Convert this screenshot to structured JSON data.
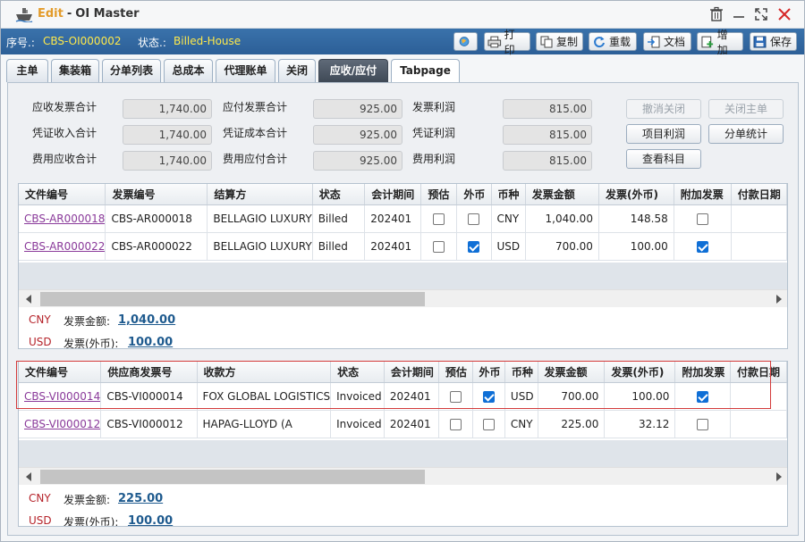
{
  "window": {
    "mode": "Edit",
    "separator": "-",
    "title": "OI Master",
    "icons": [
      "ship-icon",
      "trash-icon",
      "minimize-icon",
      "maximize-icon",
      "close-icon"
    ]
  },
  "status": {
    "seq_label": "序号.:",
    "seq_value": "CBS-OI000002",
    "state_label": "状态.:",
    "state_value": "Billed-House"
  },
  "toolbar": {
    "print": "打印",
    "copy": "复制",
    "reload": "重载",
    "docs": "文档",
    "add": "增加",
    "save": "保存"
  },
  "tabs": [
    "主单",
    "集装箱",
    "分单列表",
    "总成本",
    "代理账单",
    "关闭",
    "应收/应付",
    "Tabpage"
  ],
  "active_tab": "应收/应付",
  "summary": {
    "ar_invoice_total": {
      "label": "应收发票合计",
      "value": "1,740.00"
    },
    "voucher_income_total": {
      "label": "凭证收入合计",
      "value": "1,740.00"
    },
    "fee_ar_total": {
      "label": "费用应收合计",
      "value": "1,740.00"
    },
    "ap_invoice_total": {
      "label": "应付发票合计",
      "value": "925.00"
    },
    "voucher_cost_total": {
      "label": "凭证成本合计",
      "value": "925.00"
    },
    "fee_ap_total": {
      "label": "费用应付合计",
      "value": "925.00"
    },
    "invoice_profit": {
      "label": "发票利润",
      "value": "815.00"
    },
    "voucher_profit": {
      "label": "凭证利润",
      "value": "815.00"
    },
    "fee_profit": {
      "label": "费用利润",
      "value": "815.00"
    }
  },
  "actions": {
    "cancel_close": "撤消关闭",
    "close_master": "关闭主单",
    "project_profit": "项目利润",
    "house_stats": "分单统计",
    "view_accounts": "查看科目"
  },
  "ar_grid": {
    "headers": [
      "文件编号",
      "发票编号",
      "结算方",
      "状态",
      "会计期间",
      "预估",
      "外币",
      "币种",
      "发票金额",
      "发票(外币)",
      "附加发票",
      "付款日期"
    ],
    "rows": [
      {
        "file_no": "CBS-AR000018",
        "invoice_no": "CBS-AR000018",
        "party": "BELLAGIO LUXURY",
        "status": "Billed",
        "period": "202401",
        "estimate": false,
        "foreign": false,
        "currency": "CNY",
        "amount": "1,040.00",
        "amount_fc": "148.58",
        "extra": false
      },
      {
        "file_no": "CBS-AR000022",
        "invoice_no": "CBS-AR000022",
        "party": "BELLAGIO LUXURY",
        "status": "Billed",
        "period": "202401",
        "estimate": false,
        "foreign": true,
        "currency": "USD",
        "amount": "700.00",
        "amount_fc": "100.00",
        "extra": true
      }
    ],
    "totals": {
      "cny_label": "CNY",
      "invoice_amount_label": "发票金额:",
      "invoice_amount": "1,040.00",
      "usd_label": "USD",
      "foreign_label": "发票(外币):",
      "foreign_amount": "100.00"
    }
  },
  "ap_grid": {
    "headers": [
      "文件编号",
      "供应商发票号",
      "收款方",
      "状态",
      "会计期间",
      "预估",
      "外币",
      "币种",
      "发票金额",
      "发票(外币)",
      "附加发票",
      "付款日期"
    ],
    "rows": [
      {
        "file_no": "CBS-VI000014",
        "invoice_no": "CBS-VI000014",
        "party": "FOX GLOBAL LOGISTICS",
        "status": "Invoiced",
        "period": "202401",
        "estimate": false,
        "foreign": true,
        "currency": "USD",
        "amount": "700.00",
        "amount_fc": "100.00",
        "extra": true
      },
      {
        "file_no": "CBS-VI000012",
        "invoice_no": "CBS-VI000012",
        "party": "HAPAG-LLOYD (A",
        "status": "Invoiced",
        "period": "202401",
        "estimate": false,
        "foreign": false,
        "currency": "CNY",
        "amount": "225.00",
        "amount_fc": "32.12",
        "extra": false
      }
    ],
    "totals": {
      "cny_label": "CNY",
      "invoice_amount_label": "发票金额:",
      "invoice_amount": "225.00",
      "usd_label": "USD",
      "foreign_label": "发票(外币):",
      "foreign_amount": "100.00"
    }
  },
  "colors": {
    "status_bar": "#2c5f97",
    "status_value": "#ffe94a",
    "edit_mode": "#e39b2a",
    "currency_label": "#b5232a",
    "link": "#8a3a9a",
    "highlight": "#d33a3a"
  }
}
